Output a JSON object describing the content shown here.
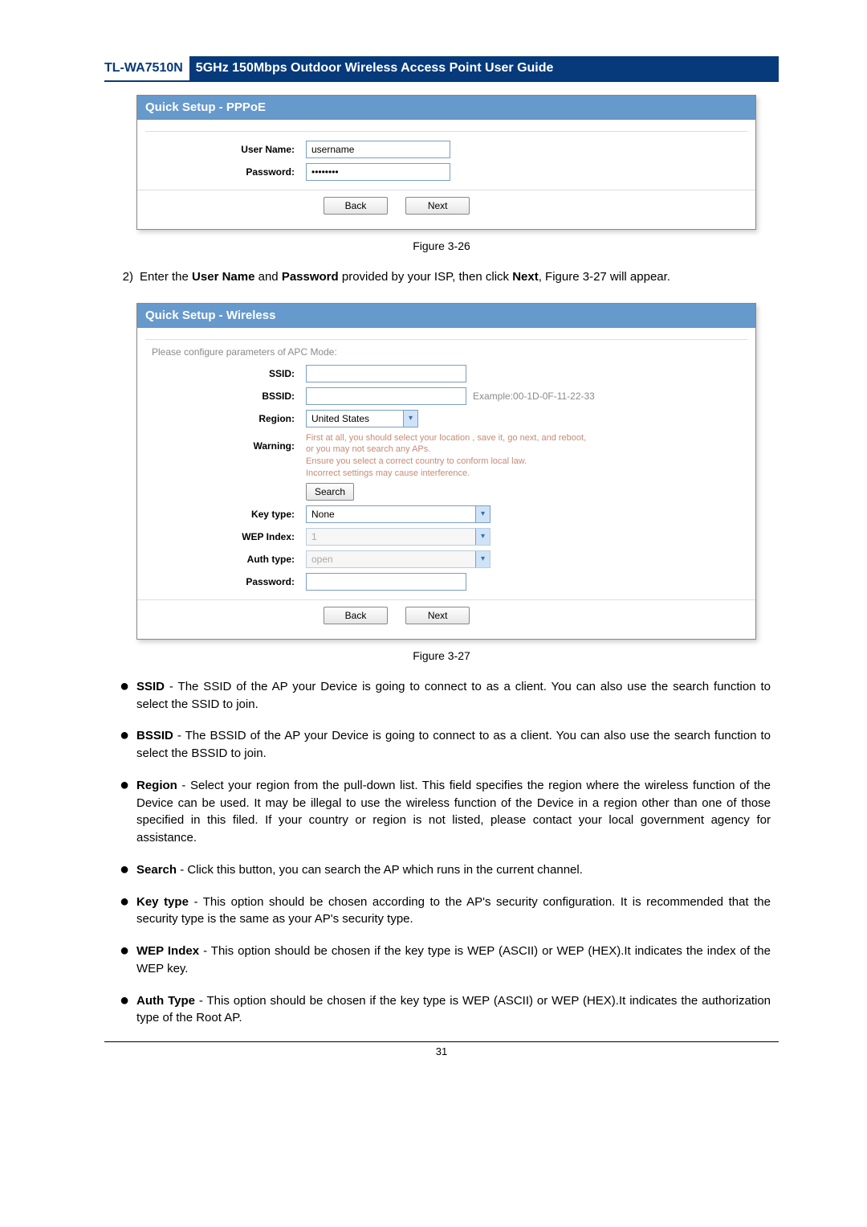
{
  "header": {
    "model": "TL-WA7510N",
    "title": "5GHz 150Mbps Outdoor Wireless Access Point User Guide"
  },
  "fig26": {
    "panel_title": "Quick Setup - PPPoE",
    "user_name_label": "User Name:",
    "user_name_value": "username",
    "password_label": "Password:",
    "password_value": "••••••••",
    "back": "Back",
    "next": "Next",
    "caption": "Figure 3-26"
  },
  "para2": {
    "num": "2)",
    "pre": "Enter the ",
    "b1": "User Name",
    "mid1": " and ",
    "b2": "Password",
    "mid2": " provided by your ISP, then click ",
    "b3": "Next",
    "post": ", Figure 3-27 will appear."
  },
  "fig27": {
    "panel_title": "Quick Setup - Wireless",
    "intro": "Please configure parameters of APC Mode:",
    "ssid_label": "SSID:",
    "bssid_label": "BSSID:",
    "bssid_example": "Example:00-1D-0F-11-22-33",
    "region_label": "Region:",
    "region_value": "United States",
    "warning_label": "Warning:",
    "warning_line1": "First at all, you should select your location , save it, go next, and reboot,",
    "warning_line2": "or you may not search any APs.",
    "warning_line3": "Ensure you select a correct country to conform local law.",
    "warning_line4": "Incorrect settings may cause interference.",
    "search": "Search",
    "key_type_label": "Key type:",
    "key_type_value": "None",
    "wep_label": "WEP Index:",
    "wep_value": "1",
    "auth_label": "Auth type:",
    "auth_value": "open",
    "password_label": "Password:",
    "back": "Back",
    "next": "Next",
    "caption": "Figure 3-27"
  },
  "bullets": {
    "b1_t": "SSID",
    "b1": " - The SSID of the AP your Device is going to connect to as a client. You can also use the search function to select the SSID to join.",
    "b2_t": "BSSID",
    "b2": " - The BSSID of the AP your Device is going to connect to as a client. You can also use the search function to select the BSSID to join.",
    "b3_t": "Region",
    "b3": " - Select your region from the pull-down list. This field specifies the region where the wireless function of the Device can be used. It may be illegal to use the wireless function of the Device in a region other than one of those specified in this filed. If your country or region is not listed, please contact your local government agency for assistance.",
    "b4_t": "Search",
    "b4": " - Click this button, you can search the AP which runs in the current channel.",
    "b5_t": "Key type",
    "b5": " - This option should be chosen according to the AP's security configuration. It is recommended that the security type is the same as your AP's security type.",
    "b6_t": "WEP Index",
    "b6": " - This option should be chosen if the key type is WEP (ASCII) or WEP (HEX).It indicates the index of the WEP key.",
    "b7_t": "Auth Type",
    "b7": " - This option should be chosen if the key type is WEP (ASCII) or WEP (HEX).It indicates the authorization type of the Root AP."
  },
  "page_number": "31"
}
